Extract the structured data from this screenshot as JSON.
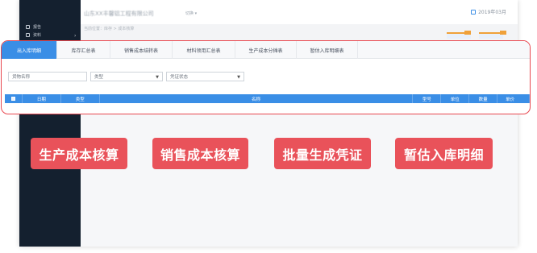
{
  "app": {
    "company_name": "山东XX丰馨铝工程有限公司",
    "company_sub": "切换 ▾",
    "date": "2019年03月",
    "breadcrumb": "当前位置：库存 > 成本核算",
    "sidebar_items": [
      "报告",
      "资料"
    ]
  },
  "panel": {
    "tabs": [
      {
        "label": "出入库明细",
        "active": true
      },
      {
        "label": "库存汇总表",
        "active": false
      },
      {
        "label": "销售成本结转表",
        "active": false
      },
      {
        "label": "材料领用汇总表",
        "active": false
      },
      {
        "label": "生产成本分摊表",
        "active": false
      },
      {
        "label": "暂估入库明细表",
        "active": false
      }
    ],
    "filters": {
      "goods_placeholder": "货物名称",
      "type_label": "类型",
      "voucher_label": "凭证状态"
    },
    "columns": [
      "日期",
      "类型",
      "名称",
      "型号",
      "单位",
      "数量",
      "单价"
    ]
  },
  "features": [
    "生产成本核算",
    "销售成本核算",
    "批量生成凭证",
    "暂估入库明细"
  ],
  "colors": {
    "accent": "#3a8ee6",
    "highlight_border": "#e8474f",
    "feature_bg": "#e9525a",
    "sidebar_bg": "#14202f"
  }
}
